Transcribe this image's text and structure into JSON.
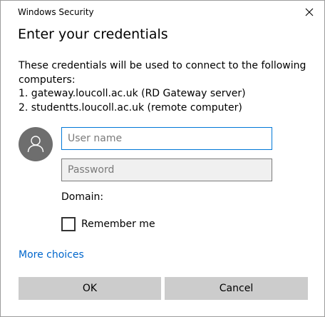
{
  "window": {
    "title": "Windows Security",
    "close_icon": "close-icon"
  },
  "dialog": {
    "heading": "Enter your credentials",
    "description_lines": [
      "These credentials will be used to connect to the following",
      "computers:",
      "1. gateway.loucoll.ac.uk (RD Gateway server)",
      "2. studentts.loucoll.ac.uk (remote computer)"
    ]
  },
  "form": {
    "avatar_icon": "user-icon",
    "username": {
      "value": "",
      "placeholder": "User name"
    },
    "password": {
      "value": "",
      "placeholder": "Password"
    },
    "domain_label": "Domain:",
    "remember_me": {
      "label": "Remember me",
      "checked": false
    }
  },
  "links": {
    "more_choices": "More choices"
  },
  "buttons": {
    "ok": "OK",
    "cancel": "Cancel"
  },
  "colors": {
    "accent": "#0078d7",
    "link": "#0066cc",
    "button_bg": "#cccccc",
    "avatar_bg": "#6e6e6e"
  }
}
